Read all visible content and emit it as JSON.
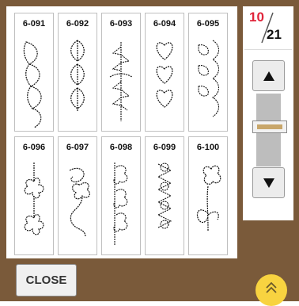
{
  "patterns": [
    {
      "code": "6-091",
      "icon": "vertical-leaf-vine-icon"
    },
    {
      "code": "6-092",
      "icon": "stacked-leaves-icon"
    },
    {
      "code": "6-093",
      "icon": "fern-leaves-icon"
    },
    {
      "code": "6-094",
      "icon": "heart-chain-icon"
    },
    {
      "code": "6-095",
      "icon": "tulip-scallop-icon"
    },
    {
      "code": "6-096",
      "icon": "four-petal-flowers-icon"
    },
    {
      "code": "6-097",
      "icon": "swirl-flower-icon"
    },
    {
      "code": "6-098",
      "icon": "clover-chain-icon"
    },
    {
      "code": "6-099",
      "icon": "small-clover-chain-icon"
    },
    {
      "code": "6-100",
      "icon": "single-flower-stem-icon"
    }
  ],
  "page": {
    "current": "10",
    "total": "21"
  },
  "scroll": {
    "up_icon": "triangle-up-icon",
    "down_icon": "triangle-down-icon"
  },
  "close_label": "CLOSE",
  "expand_icon": "double-chevron-up-icon",
  "colors": {
    "background": "#7a5a3a",
    "page_current": "#e0243a",
    "expand_button": "#f8d340",
    "thumb_accent": "#c8a66a"
  }
}
